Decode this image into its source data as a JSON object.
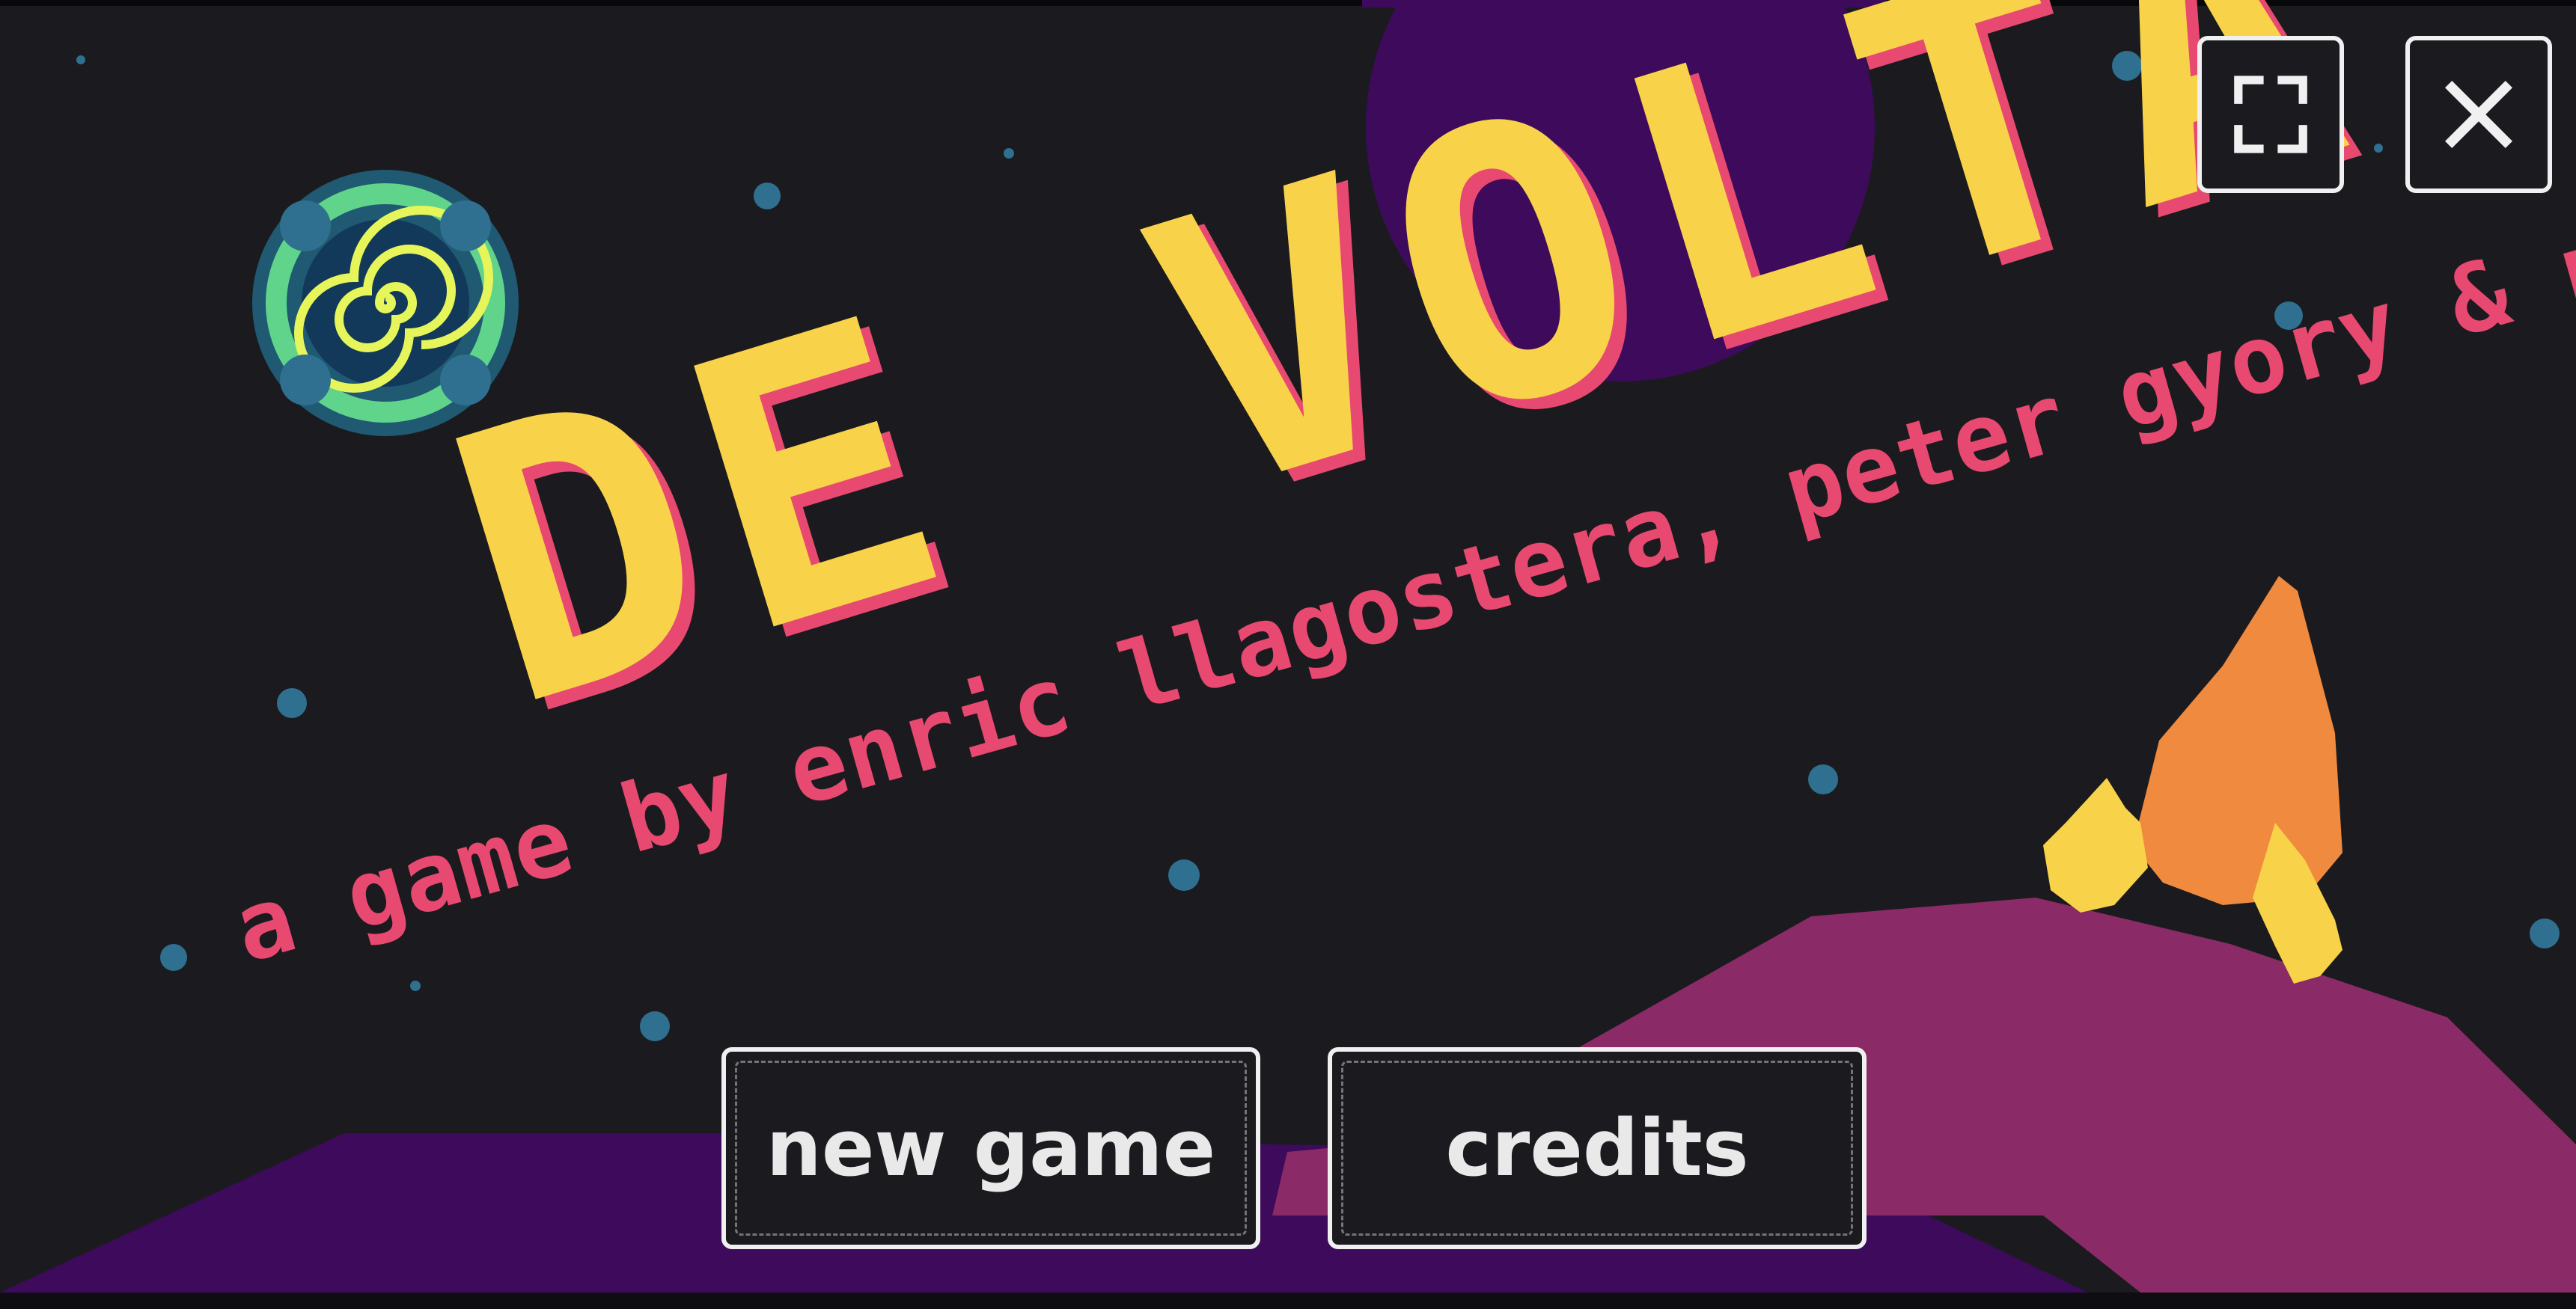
{
  "game": {
    "title": "DE VOLTA",
    "byline": "a game by enric llagostera, peter gyory & perry owens"
  },
  "menu": {
    "new_game_label": "new game",
    "credits_label": "credits"
  },
  "window_controls": {
    "fullscreen_icon": "fullscreen-icon",
    "close_icon": "close-icon"
  },
  "colors": {
    "title": "#f8d34a",
    "title_shadow": "#e84970",
    "byline": "#e84970",
    "background": "#1b1b1f",
    "planet": "#3d0a5c",
    "ground": "#8a2a66",
    "star": "#2f6f8f",
    "rocket": "#f08a3e"
  }
}
